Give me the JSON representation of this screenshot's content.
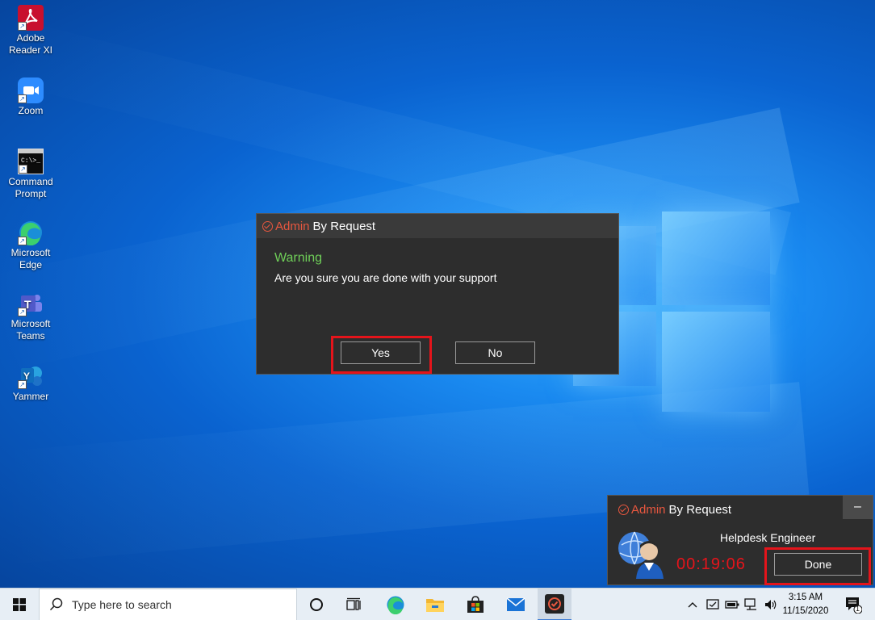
{
  "desktop_icons": [
    {
      "label": "Adobe Reader XI",
      "icon": "adobe-reader-icon"
    },
    {
      "label": "Zoom",
      "icon": "zoom-icon"
    },
    {
      "label": "Command Prompt",
      "icon": "command-prompt-icon"
    },
    {
      "label": "Microsoft Edge",
      "icon": "edge-icon"
    },
    {
      "label": "Microsoft Teams",
      "icon": "teams-icon"
    },
    {
      "label": "Yammer",
      "icon": "yammer-icon"
    }
  ],
  "dialog": {
    "brand_admin": "Admin",
    "brand_by": "By Request",
    "heading": "Warning",
    "message": "Are you sure you are done with your support",
    "yes_label": "Yes",
    "no_label": "No"
  },
  "widget": {
    "brand_admin": "Admin",
    "brand_by": "By Request",
    "minimize_label": "–",
    "role": "Helpdesk Engineer",
    "timer": "00:19:06",
    "done_label": "Done"
  },
  "taskbar": {
    "search_placeholder": "Type here to search",
    "time": "3:15 AM",
    "date": "11/15/2020",
    "notification_count": "1"
  },
  "colors": {
    "accent": "#e8573f",
    "warning": "#6fcf58",
    "timer": "#e5141b",
    "highlight": "#e4141b"
  }
}
